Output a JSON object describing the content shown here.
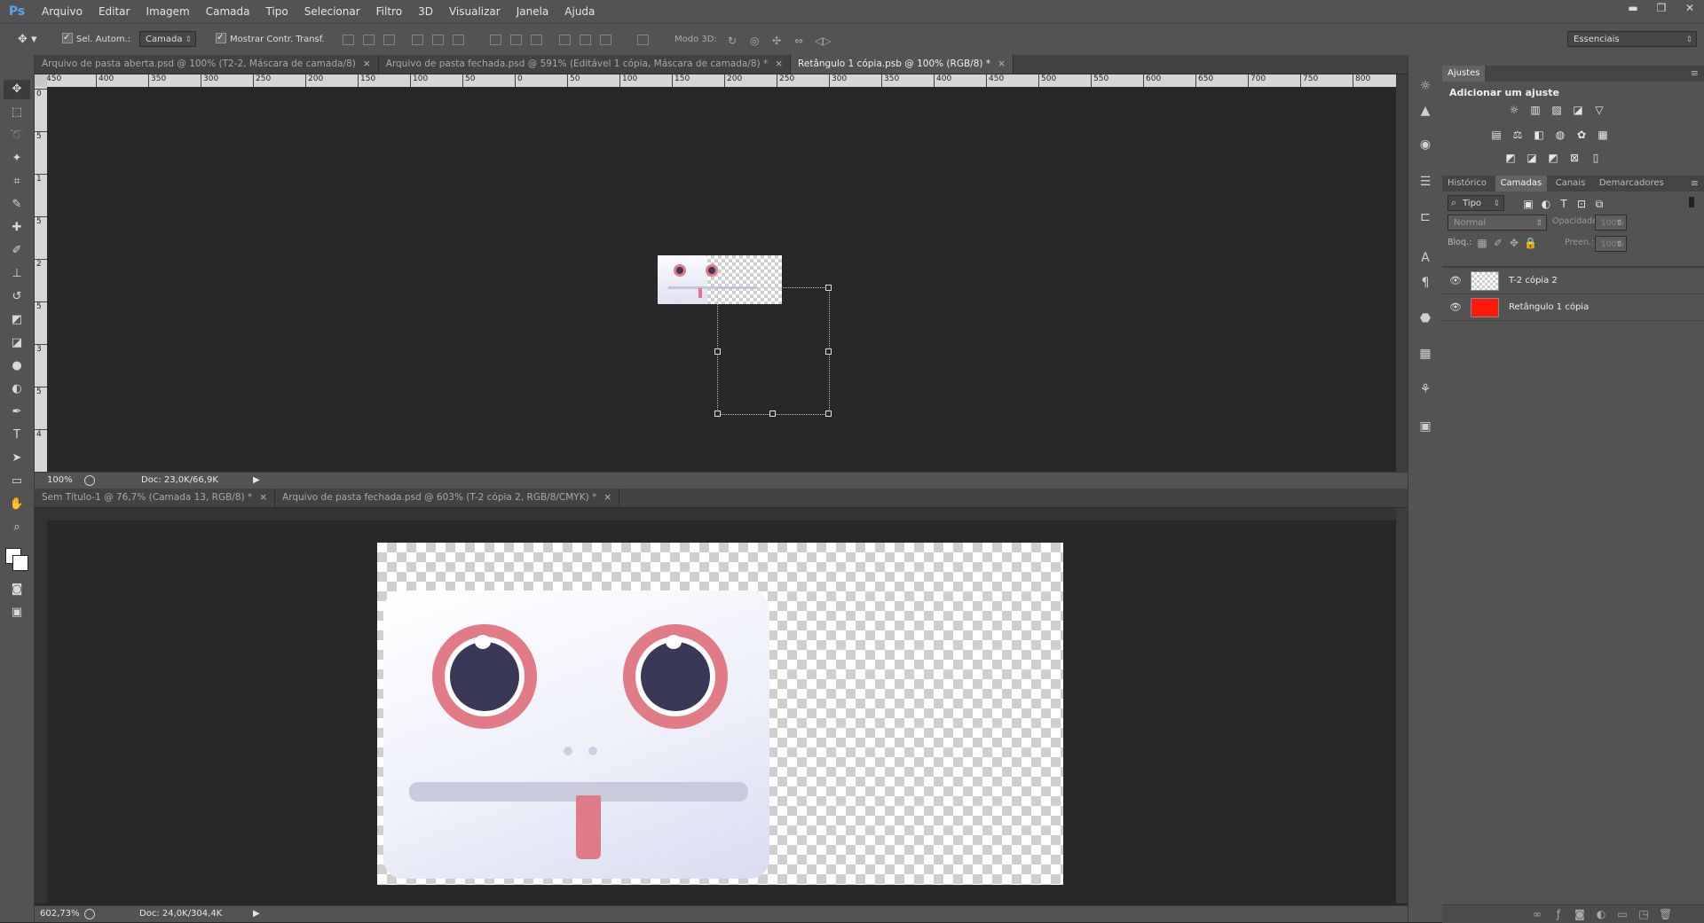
{
  "app": {
    "logo": "Ps"
  },
  "menu": [
    "Arquivo",
    "Editar",
    "Imagem",
    "Camada",
    "Tipo",
    "Selecionar",
    "Filtro",
    "3D",
    "Visualizar",
    "Janela",
    "Ajuda"
  ],
  "window_controls": {
    "minimize": "▬",
    "restore": "❐",
    "close": "✕"
  },
  "options": {
    "auto_select_label": "Sel. Autom.:",
    "auto_select_target": "Camada",
    "show_transform_label": "Mostrar Contr. Transf.",
    "mode_3d_label": "Modo 3D:",
    "workspace": "Essenciais"
  },
  "tools": [
    "move-icon",
    "marquee-icon",
    "lasso-icon",
    "magic-wand-icon",
    "crop-icon",
    "eyedropper-icon",
    "healing-brush-icon",
    "brush-icon",
    "clone-stamp-icon",
    "history-brush-icon",
    "eraser-icon",
    "paint-bucket-icon",
    "blur-icon",
    "dodge-icon",
    "pen-icon",
    "type-icon",
    "path-select-icon",
    "shape-icon",
    "hand-icon",
    "zoom-icon"
  ],
  "top_doc": {
    "tabs": [
      {
        "label": "Arquivo de pasta aberta.psd @ 100% (T2-2, Máscara de camada/8)",
        "close": "×"
      },
      {
        "label": "Arquivo de pasta fechada.psd @ 591% (Editável 1 cópia, Máscara de camada/8) *",
        "close": "×"
      },
      {
        "label": "Retângulo 1 cópia.psb @ 100% (RGB/8) *",
        "close": "×"
      }
    ],
    "ruler_ticks": [
      "450",
      "400",
      "350",
      "300",
      "250",
      "200",
      "150",
      "100",
      "50",
      "0",
      "50",
      "100",
      "150",
      "200",
      "250",
      "300",
      "350",
      "400",
      "450",
      "500",
      "550",
      "600",
      "650",
      "700",
      "750",
      "800"
    ],
    "vruler_ticks": [
      "0",
      "5",
      "1",
      "5",
      "2",
      "5",
      "3",
      "5",
      "4"
    ],
    "zoom": "100%",
    "doc_info": "Doc: 23,0K/66,9K"
  },
  "bottom_doc": {
    "tabs": [
      {
        "label": "Sem Título-1 @ 76,7% (Camada 13, RGB/8) *",
        "close": "×"
      },
      {
        "label": "Arquivo de pasta fechada.psd @ 603% (T-2 cópia 2, RGB/8/CMYK) *",
        "close": "×"
      }
    ],
    "zoom": "602,73%",
    "doc_info": "Doc: 24,0K/304,4K"
  },
  "panels": {
    "adjustments_tab": "Ajustes",
    "adjustments_title": "Adicionar um ajuste",
    "layer_tabs": [
      "Histórico",
      "Camadas",
      "Canais",
      "Demarcadores"
    ],
    "filter_kind": "Tipo",
    "blend_mode": "Normal",
    "opacity_label": "Opacidade:",
    "opacity_value": "100%",
    "lock_label": "Bloq.:",
    "fill_label": "Preen.:",
    "fill_value": "100%",
    "layers": [
      {
        "name": "T-2 cópia 2",
        "thumb": "checker"
      },
      {
        "name": "Retângulo 1 cópia",
        "thumb": "#ff1a0a"
      }
    ]
  }
}
